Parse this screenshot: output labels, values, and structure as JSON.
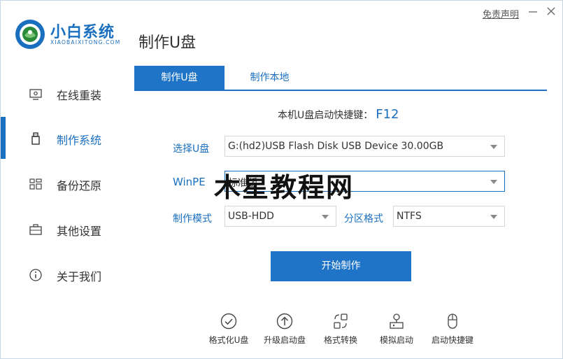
{
  "header": {
    "brand_name": "小白系统",
    "brand_sub": "XIAOBAIXITONG.COM",
    "page_title": "制作U盘",
    "disclaimer": "免责声明"
  },
  "sidebar": {
    "items": [
      {
        "label": "在线重装",
        "icon": "monitor-icon"
      },
      {
        "label": "制作系统",
        "icon": "usb-icon"
      },
      {
        "label": "备份还原",
        "icon": "backup-icon"
      },
      {
        "label": "其他设置",
        "icon": "briefcase-icon"
      },
      {
        "label": "关于我们",
        "icon": "info-icon"
      }
    ],
    "active_index": 1
  },
  "tabs": [
    {
      "label": "制作U盘"
    },
    {
      "label": "制作本地"
    }
  ],
  "hotkey": {
    "label": "本机U盘启动快捷键：",
    "key": "F12"
  },
  "form": {
    "usb_label": "选择U盘",
    "usb_value": "G:(hd2)USB Flash Disk USB Device 30.00GB",
    "winpe_label": "WinPE",
    "winpe_value": "标准版",
    "mode_label": "制作模式",
    "mode_value": "USB-HDD",
    "partition_label": "分区格式",
    "partition_value": "NTFS"
  },
  "start_button": "开始制作",
  "tools": [
    {
      "label": "格式化U盘",
      "icon": "check-circle-icon"
    },
    {
      "label": "升级启动盘",
      "icon": "upgrade-icon"
    },
    {
      "label": "格式转换",
      "icon": "convert-icon"
    },
    {
      "label": "模拟启动",
      "icon": "simulate-icon"
    },
    {
      "label": "启动快捷键",
      "icon": "mouse-icon"
    }
  ],
  "watermark": "木星教程网",
  "colors": {
    "accent": "#1f74c7",
    "text": "#333333"
  }
}
